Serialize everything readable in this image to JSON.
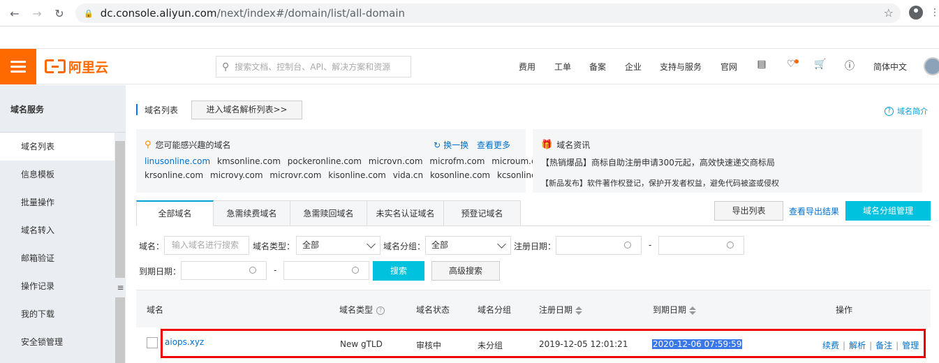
{
  "browser": {
    "url_domain": "dc.console.aliyun.com",
    "url_path": "/next/index#/domain/list/all-domain"
  },
  "topbar": {
    "brand": "阿里云",
    "search_placeholder": "搜索文档、控制台、API、解决方案和资源",
    "nav": [
      "费用",
      "工单",
      "备案",
      "企业",
      "支持与服务",
      "官网"
    ],
    "language": "简体中文",
    "accent_color": "#ff6a00"
  },
  "sidebar": {
    "title": "域名服务",
    "items": [
      {
        "label": "域名列表",
        "active": true
      },
      {
        "label": "信息模板"
      },
      {
        "label": "批量操作"
      },
      {
        "label": "域名转入"
      },
      {
        "label": "邮箱验证"
      },
      {
        "label": "操作记录"
      },
      {
        "label": "我的下载"
      },
      {
        "label": "安全锁管理"
      }
    ]
  },
  "header": {
    "title": "域名列表",
    "goto_button": "进入域名解析列表>>",
    "help_link": "域名简介"
  },
  "interest_card": {
    "title": "您可能感兴趣的域名",
    "refresh": "换一换",
    "more": "查看更多",
    "row1": [
      "linusonline.com",
      "kmsonline.com",
      "pockeronline.com",
      "microvn.com",
      "microfm.com",
      "microum.com"
    ],
    "row2": [
      "krsonline.com",
      "microvy.com",
      "microvr.com",
      "kisonline.com",
      "vida.cn",
      "kosonline.com",
      "kcsonline.com"
    ]
  },
  "news_card": {
    "title": "域名资讯",
    "line1": "【热销爆品】商标自助注册申请300元起，高效快速递交商标局",
    "line2": "【新品发布】软件著作权登记，保护开发者权益，避免代码被盗或侵权"
  },
  "tabs": [
    "全部域名",
    "急需续费域名",
    "急需赎回域名",
    "未实名认证域名",
    "预登记域名"
  ],
  "toolbar": {
    "export": "导出列表",
    "view_export": "查看导出结果",
    "group_mgmt": "域名分组管理"
  },
  "filters": {
    "domain_label": "域名：",
    "domain_placeholder": "输入域名进行搜索",
    "type_label": "域名类型：",
    "type_value": "全部",
    "group_label": "域名分组：",
    "group_value": "全部",
    "reg_label": "注册日期：",
    "exp_label": "到期日期：",
    "dash": "-",
    "search_button": "搜索",
    "advanced_button": "高级搜索"
  },
  "table": {
    "columns": [
      "域名",
      "域名类型",
      "域名状态",
      "域名分组",
      "注册日期",
      "到期日期",
      "操作"
    ],
    "rows": [
      {
        "domain": "aiops.xyz",
        "type": "New gTLD",
        "status": "审核中",
        "group": "未分组",
        "registered": "2019-12-05 12:01:21",
        "expires": "2020-12-06 07:59:59",
        "actions": [
          "续费",
          "解析",
          "备注",
          "管理"
        ]
      }
    ]
  }
}
